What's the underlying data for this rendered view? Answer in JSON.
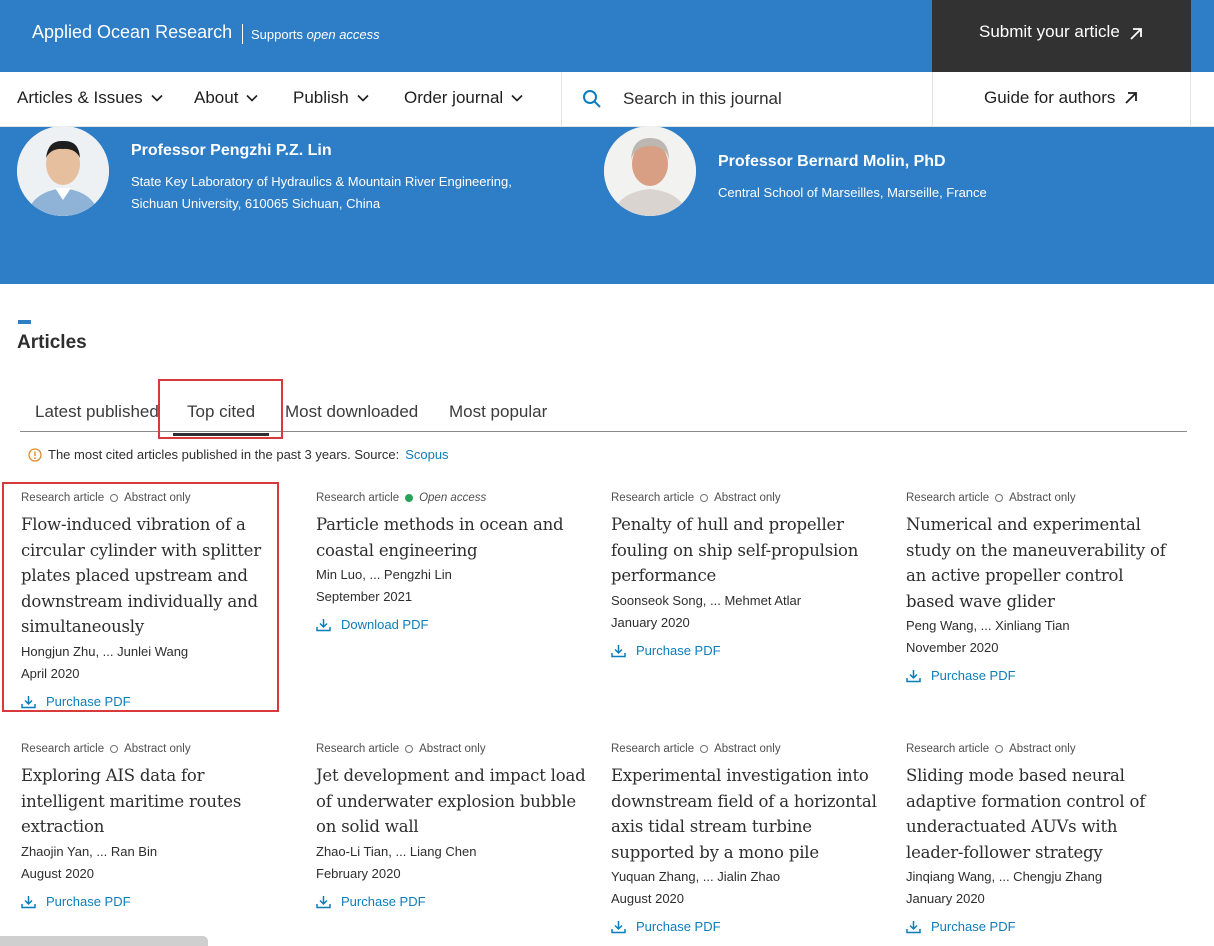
{
  "header": {
    "journal_title": "Applied Ocean Research",
    "supports_prefix": "Supports",
    "supports_oa": "open access",
    "submit_label": "Submit your article"
  },
  "nav": {
    "items": [
      {
        "label": "Articles & Issues"
      },
      {
        "label": "About"
      },
      {
        "label": "Publish"
      },
      {
        "label": "Order journal"
      }
    ],
    "search_placeholder": "Search in this journal",
    "guide_label": "Guide for authors"
  },
  "editors": [
    {
      "name": "Professor Pengzhi P.Z. Lin",
      "affiliation_line1": "State Key Laboratory of Hydraulics & Mountain River Engineering,",
      "affiliation_line2": "Sichuan University, 610065 Sichuan, China"
    },
    {
      "name": "Professor Bernard Molin, PhD",
      "affiliation_line1": "Central School of Marseilles, Marseille, France"
    }
  ],
  "articles_section": {
    "title": "Articles",
    "tabs": [
      {
        "label": "Latest published"
      },
      {
        "label": "Top cited"
      },
      {
        "label": "Most downloaded"
      },
      {
        "label": "Most popular"
      }
    ],
    "active_tab": "Top cited",
    "info_text": "The most cited articles published in the past 3 years. Source:",
    "info_link": "Scopus"
  },
  "articles": [
    {
      "type": "Research article",
      "access": "Abstract only",
      "title": "Flow-induced vibration of a circular cylinder with splitter plates placed upstream and downstream individually and simultaneously",
      "authors": "Hongjun Zhu, ... Junlei Wang",
      "date": "April 2020",
      "action": "Purchase PDF"
    },
    {
      "type": "Research article",
      "access": "Open access",
      "title": "Particle methods in ocean and coastal engineering",
      "authors": "Min Luo, ... Pengzhi Lin",
      "date": "September 2021",
      "action": "Download PDF"
    },
    {
      "type": "Research article",
      "access": "Abstract only",
      "title": "Penalty of hull and propeller fouling on ship self-propulsion performance",
      "authors": "Soonseok Song, ... Mehmet Atlar",
      "date": "January 2020",
      "action": "Purchase PDF"
    },
    {
      "type": "Research article",
      "access": "Abstract only",
      "title": "Numerical and experimental study on the maneuverability of an active propeller control based wave glider",
      "authors": "Peng Wang, ... Xinliang Tian",
      "date": "November 2020",
      "action": "Purchase PDF"
    },
    {
      "type": "Research article",
      "access": "Abstract only",
      "title": "Exploring AIS data for intelligent maritime routes extraction",
      "authors": "Zhaojin Yan, ... Ran Bin",
      "date": "August 2020",
      "action": "Purchase PDF"
    },
    {
      "type": "Research article",
      "access": "Abstract only",
      "title": "Jet development and impact load of underwater explosion bubble on solid wall",
      "authors": "Zhao-Li Tian, ... Liang Chen",
      "date": "February 2020",
      "action": "Purchase PDF"
    },
    {
      "type": "Research article",
      "access": "Abstract only",
      "title": "Experimental investigation into downstream field of a horizontal axis tidal stream turbine supported by a mono pile",
      "authors": "Yuquan Zhang, ... Jialin Zhao",
      "date": "August 2020",
      "action": "Purchase PDF"
    },
    {
      "type": "Research article",
      "access": "Abstract only",
      "title": "Sliding mode based neural adaptive formation control of underactuated AUVs with leader-follower strategy",
      "authors": "Jinqiang Wang, ... Chengju Zhang",
      "date": "January 2020",
      "action": "Purchase PDF"
    }
  ],
  "colors": {
    "brand_blue": "#2d7dc7",
    "dark_box": "#323232",
    "link_blue": "#0c7dbb",
    "highlight_red": "#d9393b",
    "open_access_green": "#29a35a"
  }
}
